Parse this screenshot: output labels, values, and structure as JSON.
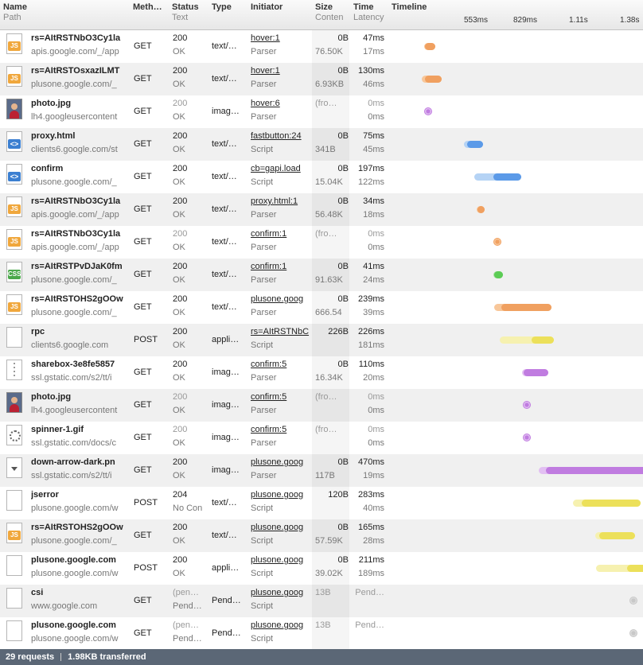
{
  "header": {
    "name": "Name",
    "path": "Path",
    "method": "Meth…",
    "status": "Status",
    "status_text": "Text",
    "type": "Type",
    "initiator": "Initiator",
    "size": "Size",
    "content": "Conten",
    "time": "Time",
    "latency": "Latency",
    "timeline": "Timeline",
    "ticks": [
      "553ms",
      "829ms",
      "1.11s",
      "1.38s"
    ]
  },
  "colors": {
    "js": "#f0a73c",
    "css": "#4aa84a",
    "html": "#3b7fd1",
    "image": "#b05fd6",
    "xhr": "#e8d837",
    "pending": "#c8c8c8"
  },
  "rows": [
    {
      "icon": "js-icon",
      "name": "rs=AItRSTNbO3Cy1la",
      "path": "apis.google.com/_/app",
      "method": "GET",
      "status": "200",
      "status_text": "OK",
      "type": "text/…",
      "initiator": "hover:1",
      "initiator_type": "Parser",
      "size": "0B",
      "content": "76.50K",
      "time": "47ms",
      "latency": "17ms",
      "kind": "js",
      "start": 0.138,
      "lat": 0.092,
      "total": 0.153
    },
    {
      "icon": "js-icon",
      "name": "rs=AItRSTOsxazILMT",
      "path": "plusone.google.com/_",
      "method": "GET",
      "status": "200",
      "status_text": "OK",
      "type": "text/…",
      "initiator": "hover:1",
      "initiator_type": "Parser",
      "size": "0B",
      "content": "6.93KB",
      "time": "130ms",
      "latency": "46ms",
      "kind": "js",
      "start": 0.131,
      "lat": 0.148,
      "total": 0.276
    },
    {
      "icon": "photo-icon",
      "name": "photo.jpg",
      "path": "lh4.googleusercontent",
      "method": "GET",
      "status": "200",
      "status_text": "OK",
      "type": "imag…",
      "initiator": "hover:6",
      "initiator_type": "Parser",
      "size": "(fro…",
      "content": "",
      "time": "0ms",
      "latency": "0ms",
      "kind": "image",
      "start": 0.141,
      "lat": 0.0,
      "total": 0.0,
      "grey": true
    },
    {
      "icon": "html-icon",
      "name": "proxy.html",
      "path": "clients6.google.com/st",
      "method": "GET",
      "status": "200",
      "status_text": "OK",
      "type": "text/…",
      "initiator": "fastbutton:24",
      "initiator_type": "Script",
      "size": "0B",
      "content": "341B",
      "time": "75ms",
      "latency": "45ms",
      "kind": "html",
      "start": 0.301,
      "lat": 0.154,
      "total": 0.256
    },
    {
      "icon": "html-icon",
      "name": "confirm",
      "path": "plusone.google.com/_",
      "method": "GET",
      "status": "200",
      "status_text": "OK",
      "type": "text/…",
      "initiator": "cb=gapi.load",
      "initiator_type": "Script",
      "size": "0B",
      "content": "15.04K",
      "time": "197ms",
      "latency": "122ms",
      "kind": "html",
      "start": 0.343,
      "lat": 0.402,
      "total": 0.642
    },
    {
      "icon": "js-icon",
      "name": "rs=AItRSTNbO3Cy1la",
      "path": "apis.google.com/_/app",
      "method": "GET",
      "status": "200",
      "status_text": "OK",
      "type": "text/…",
      "initiator": "proxy.html:1",
      "initiator_type": "Parser",
      "size": "0B",
      "content": "56.48K",
      "time": "34ms",
      "latency": "18ms",
      "kind": "js",
      "start": 0.353,
      "lat": 0.06,
      "total": 0.114
    },
    {
      "icon": "js-icon",
      "name": "rs=AItRSTNbO3Cy1la",
      "path": "apis.google.com/_/app",
      "method": "GET",
      "status": "200",
      "status_text": "OK",
      "type": "text/…",
      "initiator": "confirm:1",
      "initiator_type": "Parser",
      "size": "(fro…",
      "content": "",
      "time": "0ms",
      "latency": "0ms",
      "kind": "js",
      "start": 0.423,
      "lat": 0.0,
      "total": 0.0,
      "grey": true
    },
    {
      "icon": "css-icon",
      "name": "rs=AItRSTPvDJaK0fm",
      "path": "plusone.google.com/_",
      "method": "GET",
      "status": "200",
      "status_text": "OK",
      "type": "text/…",
      "initiator": "confirm:1",
      "initiator_type": "Parser",
      "size": "0B",
      "content": "91.63K",
      "time": "41ms",
      "latency": "24ms",
      "kind": "css",
      "start": 0.422,
      "lat": 0.079,
      "total": 0.131
    },
    {
      "icon": "js-icon",
      "name": "rs=AItRSTOHS2gOOw",
      "path": "plusone.google.com/_",
      "method": "GET",
      "status": "200",
      "status_text": "OK",
      "type": "text/…",
      "initiator": "plusone.goog",
      "initiator_type": "Parser",
      "size": "0B",
      "content": "666.54",
      "time": "239ms",
      "latency": "39ms",
      "kind": "js",
      "start": 0.425,
      "lat": 0.128,
      "total": 0.78
    },
    {
      "icon": "file-icon",
      "name": "rpc",
      "path": "clients6.google.com",
      "method": "POST",
      "status": "200",
      "status_text": "OK",
      "type": "appli…",
      "initiator": "rs=AItRSTNbC",
      "initiator_type": "Script",
      "size": "226B",
      "content": "",
      "time": "226ms",
      "latency": "181ms",
      "kind": "xhr",
      "start": 0.449,
      "lat": 0.593,
      "total": 0.737
    },
    {
      "icon": "dotted-icon",
      "name": "sharebox-3e8fe5857",
      "path": "ssl.gstatic.com/s2/tt/i",
      "method": "GET",
      "status": "200",
      "status_text": "OK",
      "type": "imag…",
      "initiator": "confirm:5",
      "initiator_type": "Parser",
      "size": "0B",
      "content": "16.34K",
      "time": "110ms",
      "latency": "20ms",
      "kind": "image",
      "start": 0.539,
      "lat": 0.066,
      "total": 0.36
    },
    {
      "icon": "photo-icon",
      "name": "photo.jpg",
      "path": "lh4.googleusercontent",
      "method": "GET",
      "status": "200",
      "status_text": "OK",
      "type": "imag…",
      "initiator": "confirm:5",
      "initiator_type": "Parser",
      "size": "(fro…",
      "content": "",
      "time": "0ms",
      "latency": "0ms",
      "kind": "image",
      "start": 0.542,
      "lat": 0.0,
      "total": 0.0,
      "grey": true
    },
    {
      "icon": "spinner-icon",
      "name": "spinner-1.gif",
      "path": "ssl.gstatic.com/docs/c",
      "method": "GET",
      "status": "200",
      "status_text": "OK",
      "type": "imag…",
      "initiator": "confirm:5",
      "initiator_type": "Parser",
      "size": "(fro…",
      "content": "",
      "time": "0ms",
      "latency": "0ms",
      "kind": "image",
      "start": 0.542,
      "lat": 0.0,
      "total": 0.0,
      "grey": true
    },
    {
      "icon": "down-arrow-icon",
      "name": "down-arrow-dark.pn",
      "path": "ssl.gstatic.com/s2/tt/i",
      "method": "GET",
      "status": "200",
      "status_text": "OK",
      "type": "imag…",
      "initiator": "plusone.goog",
      "initiator_type": "Parser",
      "size": "0B",
      "content": "117B",
      "time": "470ms",
      "latency": "19ms",
      "kind": "image",
      "start": 0.607,
      "lat": 0.062,
      "total": 1.537
    },
    {
      "icon": "file-icon",
      "name": "jserror",
      "path": "plusone.google.com/w",
      "method": "POST",
      "status": "204",
      "status_text": "No Con",
      "type": "text/…",
      "initiator": "plusone.goog",
      "initiator_type": "Script",
      "size": "120B",
      "content": "",
      "time": "283ms",
      "latency": "40ms",
      "kind": "xhr",
      "start": 0.745,
      "lat": 0.131,
      "total": 0.925
    },
    {
      "icon": "js-icon",
      "name": "rs=AItRSTOHS2gOOw",
      "path": "plusone.google.com/_",
      "method": "GET",
      "status": "200",
      "status_text": "OK",
      "type": "text/…",
      "initiator": "plusone.goog",
      "initiator_type": "Script",
      "size": "0B",
      "content": "57.59K",
      "time": "165ms",
      "latency": "28ms",
      "kind": "xhr",
      "start": 0.837,
      "lat": 0.092,
      "total": 0.539
    },
    {
      "icon": "file-icon",
      "name": "plusone.google.com",
      "path": "plusone.google.com/w",
      "method": "POST",
      "status": "200",
      "status_text": "OK",
      "type": "appli…",
      "initiator": "plusone.goog",
      "initiator_type": "Script",
      "size": "0B",
      "content": "39.02K",
      "time": "211ms",
      "latency": "189ms",
      "kind": "xhr",
      "start": 0.84,
      "lat": 0.618,
      "total": 0.69
    },
    {
      "icon": "file-icon",
      "name": "csi",
      "path": "www.google.com",
      "method": "GET",
      "status": "(pen…",
      "status_text": "Pend…",
      "type": "Pend…",
      "initiator": "plusone.goog",
      "initiator_type": "Script",
      "size": "13B",
      "content": "",
      "time": "Pend…",
      "latency": "",
      "kind": "pending",
      "start": 0.977,
      "lat": 0.0,
      "total": 0.0,
      "grey": true
    },
    {
      "icon": "file-icon",
      "name": "plusone.google.com",
      "path": "plusone.google.com/w",
      "method": "GET",
      "status": "(pen…",
      "status_text": "Pend…",
      "type": "Pend…",
      "initiator": "plusone.goog",
      "initiator_type": "Script",
      "size": "13B",
      "content": "",
      "time": "Pend…",
      "latency": "",
      "kind": "pending",
      "start": 0.977,
      "lat": 0.0,
      "total": 0.0,
      "grey": true
    }
  ],
  "status_bar": {
    "requests": "29 requests",
    "transferred": "1.98KB transferred"
  }
}
